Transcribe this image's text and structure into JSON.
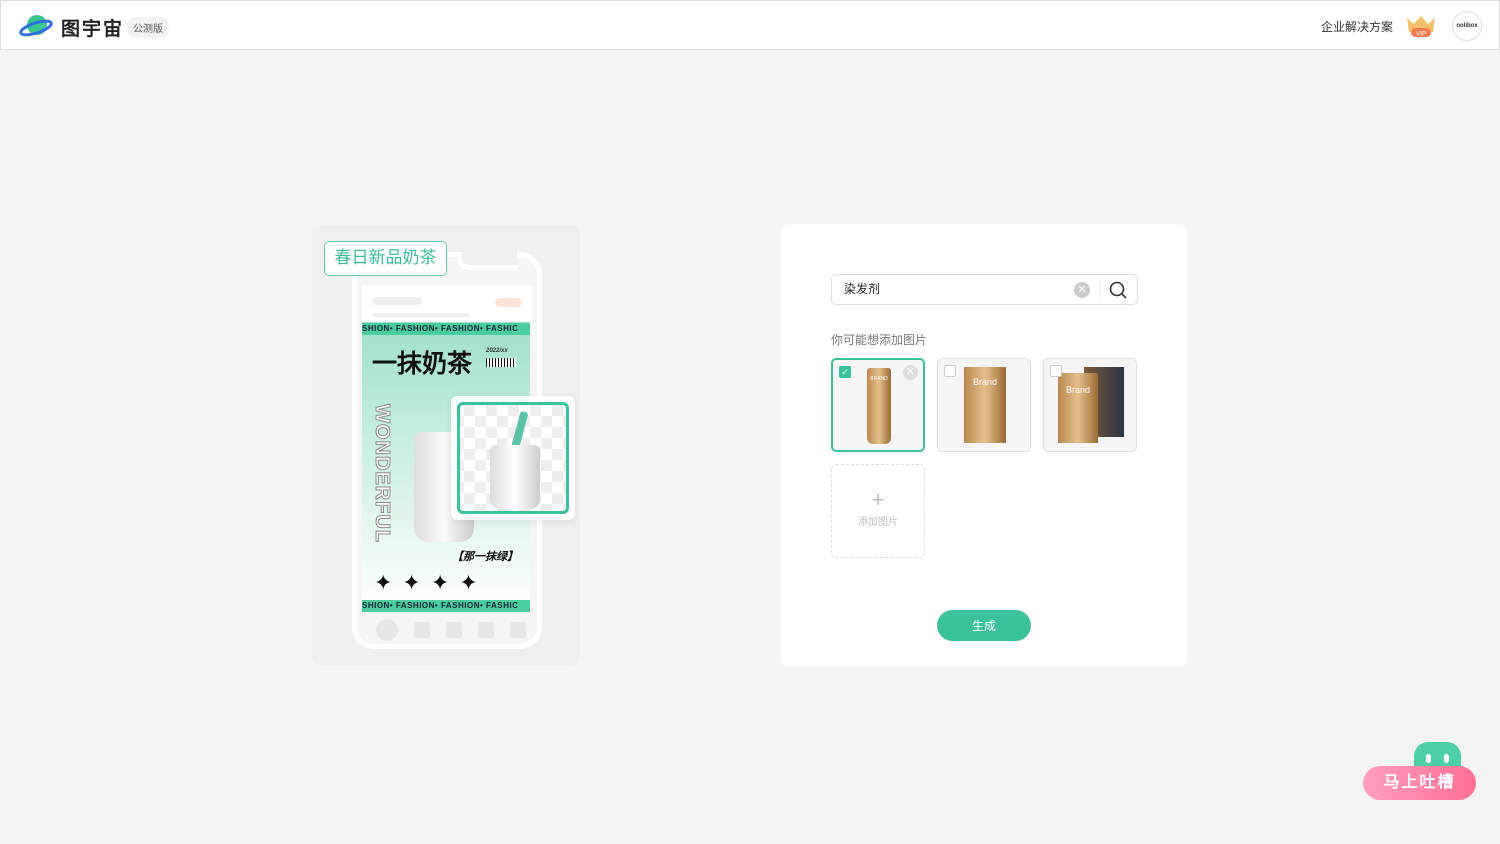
{
  "header": {
    "brand": "图宇宙",
    "beta_badge": "公测版",
    "enterprise_link": "企业解决方案",
    "vip_label": "VIP",
    "avatar_text": "nolibox"
  },
  "illustration": {
    "tag": "春日新品奶茶",
    "strip_text": "SHION• FASHION• FASHION• FASHIC",
    "title": "一抹奶茶",
    "year": "2022/xx",
    "vertical_text": "WONDERFUL",
    "slogan": "【那一抹绿】",
    "stars": "✦✦✦✦"
  },
  "panel": {
    "search": {
      "value": "染发剂"
    },
    "hint": "你可能想添加图片",
    "thumbnails": [
      {
        "label": "BRAND",
        "selected": true
      },
      {
        "label": "Brand",
        "selected": false
      },
      {
        "label": "Brand",
        "selected": false
      }
    ],
    "add_image_label": "添加图片",
    "add_icon": "+",
    "generate_button": "生成"
  },
  "feedback": {
    "label": "马上吐槽"
  },
  "colors": {
    "accent": "#3cc29b",
    "feedback": "#ff7fa3"
  }
}
